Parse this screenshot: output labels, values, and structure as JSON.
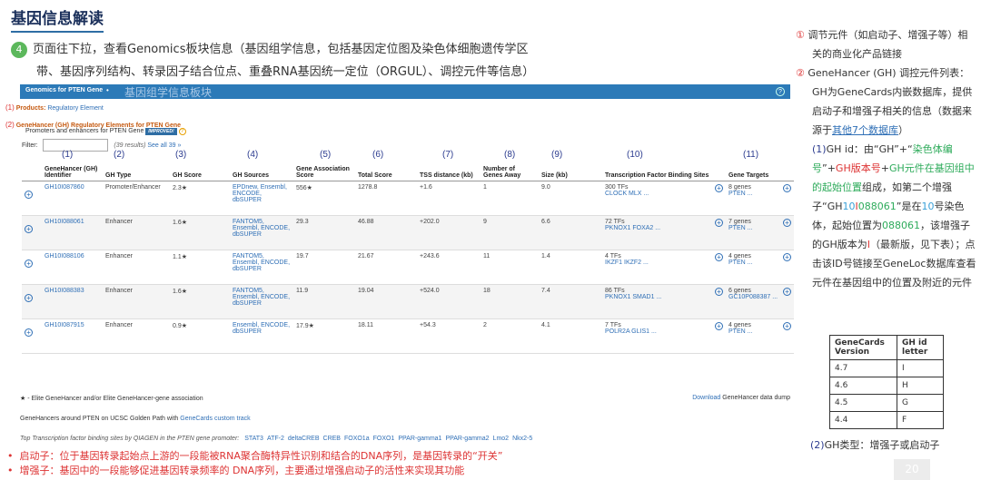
{
  "title": "基因信息解读",
  "step": {
    "number": "4",
    "line1": "页面往下拉，查看Genomics板块信息（基因组学信息，包括基因定位图及染色体细胞遗传学区",
    "line2": "带、基因序列结构、转录因子结合位点、重叠RNA基因统一定位（ORGUL）、调控元件等信息）"
  },
  "genomics_bar": {
    "heading": "Genomics for PTEN Gene",
    "overlay": "基因组学信息板块",
    "help": "?"
  },
  "products": {
    "marker": "(1)",
    "label": "Products:",
    "link": "Regulatory Element"
  },
  "genehancer": {
    "marker": "(2)",
    "heading": "GeneHancer (GH) Regulatory Elements for PTEN Gene",
    "subheading": "Promoters and enhancers for PTEN Gene",
    "badge": "IMPROVED!",
    "help": "?"
  },
  "filter": {
    "label": "Filter:",
    "results": "(39 results)",
    "see_all": "See all 39 »"
  },
  "col_numbers": [
    "(1)",
    "(2)",
    "(3)",
    "(4)",
    "(5)",
    "(6)",
    "(7)",
    "(8)",
    "(9)",
    "(10)",
    "(11)"
  ],
  "table": {
    "headers": [
      "GeneHancer (GH) Identifier",
      "GH Type",
      "GH Score",
      "GH Sources",
      "Gene Association Score",
      "Total Score",
      "TSS distance (kb)",
      "Number of Genes Away",
      "Size (kb)",
      "Transcription Factor Binding Sites",
      "Gene Targets"
    ],
    "rows": [
      {
        "id": "GH10I087860",
        "type": "Promoter/Enhancer",
        "score": "2.3★",
        "sources": "EPDnew, Ensembl, ENCODE, dbSUPER",
        "assoc": "556★",
        "total": "1278.8",
        "tss": "+1.6",
        "genes": "1",
        "size": "9.0",
        "tfs": "300 TFs",
        "tf_names": "CLOCK MLX ...",
        "targets": "8 genes",
        "target_names": "PTEN ..."
      },
      {
        "id": "GH10I088061",
        "type": "Enhancer",
        "score": "1.6★",
        "sources": "FANTOM5, Ensembl, ENCODE, dbSUPER",
        "assoc": "29.3",
        "total": "46.88",
        "tss": "+202.0",
        "genes": "9",
        "size": "6.6",
        "tfs": "72 TFs",
        "tf_names": "PKNOX1 FOXA2 ...",
        "targets": "7 genes",
        "target_names": "PTEN ..."
      },
      {
        "id": "GH10I088106",
        "type": "Enhancer",
        "score": "1.1★",
        "sources": "FANTOM5, Ensembl, ENCODE, dbSUPER",
        "assoc": "19.7",
        "total": "21.67",
        "tss": "+243.6",
        "genes": "11",
        "size": "1.4",
        "tfs": "4 TFs",
        "tf_names": "IKZF1 IKZF2 ...",
        "targets": "4 genes",
        "target_names": "PTEN ..."
      },
      {
        "id": "GH10I088383",
        "type": "Enhancer",
        "score": "1.6★",
        "sources": "FANTOM5, Ensembl, ENCODE, dbSUPER",
        "assoc": "11.9",
        "total": "19.04",
        "tss": "+524.0",
        "genes": "18",
        "size": "7.4",
        "tfs": "86 TFs",
        "tf_names": "PKNOX1 SMAD1 ...",
        "targets": "6 genes",
        "target_names": "GC10P088387 ..."
      },
      {
        "id": "GH10I087915",
        "type": "Enhancer",
        "score": "0.9★",
        "sources": "Ensembl, ENCODE, dbSUPER",
        "assoc": "17.9★",
        "total": "18.11",
        "tss": "+54.3",
        "genes": "2",
        "size": "4.1",
        "tfs": "7 TFs",
        "tf_names": "POLR2A GLIS1 ...",
        "targets": "4 genes",
        "target_names": "PTEN ..."
      }
    ]
  },
  "footnote": "★ - Elite GeneHancer and/or Elite GeneHancer-gene association",
  "download": {
    "link": "Download",
    "rest": " GeneHancer data dump"
  },
  "ucsc": {
    "text": "GeneHancers around PTEN on UCSC Golden Path with ",
    "link": "GeneCards custom track"
  },
  "tf_line": {
    "label": "Top Transcription factor binding sites by QIAGEN in the PTEN gene promoter:",
    "items": [
      "STAT3",
      "ATF-2",
      "deltaCREB",
      "CREB",
      "FOXO1a",
      "FOXO1",
      "PPAR-gamma1",
      "PPAR-gamma2",
      "Lmo2",
      "Nkx2-5"
    ]
  },
  "bullets": [
    "启动子：位于基因转录起始点上游的一段能被RNA聚合酶特异性识别和结合的DNA序列，是基因转录的“开关”",
    "增强子：基因中的一段能够促进基因转录频率的 DNA序列，主要通过增强启动子的活性来实现其功能"
  ],
  "right_panel": {
    "n1": "①",
    "p1": "调节元件（如启动子、增强子等）相关的商业化产品链接",
    "n2": "②",
    "p2a": "GeneHancer (GH) 调控元件列表：GH为GeneCards内嵌数据库，提供启动子和增强子相关的信息（数据来源于",
    "p2link": "其他7个数据库",
    "p2b": "）",
    "gh_id_label": "(1)",
    "gh_id_a": "GH id：由“GH”+“",
    "gh_id_chrom": "染色体编号",
    "gh_id_b": "”+",
    "gh_id_ver": "GH版本号",
    "gh_id_c": "+",
    "gh_id_pos": "GH元件在基因组中的起始位置",
    "gh_id_d": "组成，如第二个增强子“GH",
    "ex_chrom": "10",
    "ex_ver": "I",
    "ex_pos": "088061",
    "gh_id_e": "”是在",
    "ex_chrom2": "10",
    "gh_id_f": "号染色体，起始位置为",
    "ex_pos2": "088061",
    "gh_id_g": "，该增强子的GH版本为",
    "ex_ver2": "I",
    "gh_id_h": "（最新版，见下表）；点击该ID号链接至GeneLoc数据库查看元件在基因组中的位置及附近的元件"
  },
  "version_table": {
    "headers": [
      "GeneCards Version",
      "GH id letter"
    ],
    "rows": [
      [
        "4.7",
        "I"
      ],
      [
        "4.6",
        "H"
      ],
      [
        "4.5",
        "G"
      ],
      [
        "4.4",
        "F"
      ]
    ]
  },
  "gh_type": {
    "label": "(2)",
    "text": "GH类型：增强子或启动子"
  },
  "page_number": "20"
}
